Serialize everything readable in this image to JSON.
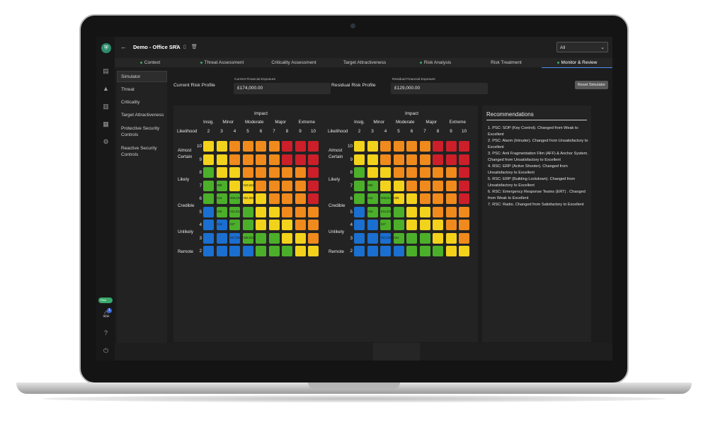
{
  "app": {
    "title": "Demo - Office SRA",
    "filter": "All",
    "logo": "shield-logo",
    "sidebar_toggle": "Risk"
  },
  "tabs": [
    {
      "label": "Context",
      "done": true
    },
    {
      "label": "Threat Assessment",
      "done": true
    },
    {
      "label": "Criticality Assessment",
      "done": false
    },
    {
      "label": "Target Attractiveness",
      "done": false
    },
    {
      "label": "Risk Analysis",
      "done": true
    },
    {
      "label": "Risk Treatment",
      "done": false
    },
    {
      "label": "Monitor & Review",
      "done": true,
      "active": true
    }
  ],
  "subnav": [
    {
      "label": "Simulator"
    },
    {
      "label": "Threat"
    },
    {
      "label": "Criticality"
    },
    {
      "label": "Target Attractiveness"
    },
    {
      "label": "Protective Security Controls"
    },
    {
      "label": "Reactive Security Controls"
    }
  ],
  "simulator": {
    "current_label": "Current Risk Profile",
    "current_fin_label": "Current Financial Exposure",
    "current_fin_value": "£174,000.00",
    "residual_label": "Residual Risk Profile",
    "residual_fin_label": "Residual Financial Exposure",
    "residual_fin_value": "£129,000.00",
    "reset_label": "Reset Simulator"
  },
  "matrix": {
    "impact_title": "Impact",
    "impact_groups": [
      "Insig.",
      "Minor",
      "Moderate",
      "Major",
      "Extreme"
    ],
    "impact_levels": [
      "2",
      "3",
      "4",
      "5",
      "6",
      "7",
      "8",
      "9",
      "10"
    ],
    "likelihood_title": "Likelihood",
    "likelihood_groups": [
      "Almost Certain",
      "Likely",
      "Credible",
      "Unlikely",
      "Remote"
    ],
    "likelihood_levels": [
      "10",
      "9",
      "8",
      "7",
      "6",
      "5",
      "4",
      "3",
      "2"
    ],
    "colors": {
      "blue": "#1a6fd0",
      "green": "#4caf2a",
      "yellow": "#f2d21b",
      "orange": "#f08a1c",
      "red": "#cc1f2a"
    },
    "current_labels": [
      {
        "row": 3,
        "col": 1,
        "text": "008"
      },
      {
        "row": 3,
        "col": 3,
        "text": "023,022,001"
      },
      {
        "row": 4,
        "col": 1,
        "text": "014"
      },
      {
        "row": 4,
        "col": 2,
        "text": "009,025,0"
      },
      {
        "row": 4,
        "col": 3,
        "text": "002,004,005"
      },
      {
        "row": 5,
        "col": 1,
        "text": "016"
      },
      {
        "row": 5,
        "col": 2,
        "text": "011,012"
      },
      {
        "row": 6,
        "col": 1,
        "text": "013"
      },
      {
        "row": 6,
        "col": 2,
        "text": "027"
      },
      {
        "row": 7,
        "col": 2,
        "text": "017,020,0"
      },
      {
        "row": 7,
        "col": 3,
        "text": "028,021"
      }
    ],
    "residual_labels": [
      {
        "row": 3,
        "col": 1,
        "text": "008"
      },
      {
        "row": 4,
        "col": 1,
        "text": "013"
      },
      {
        "row": 4,
        "col": 2,
        "text": "009,014,0"
      },
      {
        "row": 4,
        "col": 3,
        "text": "005"
      },
      {
        "row": 5,
        "col": 1,
        "text": "016"
      },
      {
        "row": 5,
        "col": 2,
        "text": "012,011"
      },
      {
        "row": 6,
        "col": 2,
        "text": "027"
      },
      {
        "row": 7,
        "col": 2,
        "text": "017,020,0"
      },
      {
        "row": 7,
        "col": 3,
        "text": "021"
      }
    ]
  },
  "recommendations": {
    "title": "Recommendations",
    "items": [
      "1. PSC: SOP (Key Control). Changed from Weak to Excellent",
      "2. PSC: Alarm (Intruder). Changed from Unsatisfactory to Excellent",
      "3. PSC: Anti Fragmentation Film (AFF) & Anchor System. Changed from Unsatisfactory to Excellent",
      "4. RSC: ERP (Active Shooter). Changed from Unsatisfactory to Excellent",
      "5. RSC: ERP (Building Lockdown). Changed from Unsatisfactory to Excellent",
      "6. RSC: Emergency Response Teams (ERT) . Changed from Weak to Excellent",
      "7. RSC: Radio. Changed from Satisfactory to Excellent"
    ]
  }
}
